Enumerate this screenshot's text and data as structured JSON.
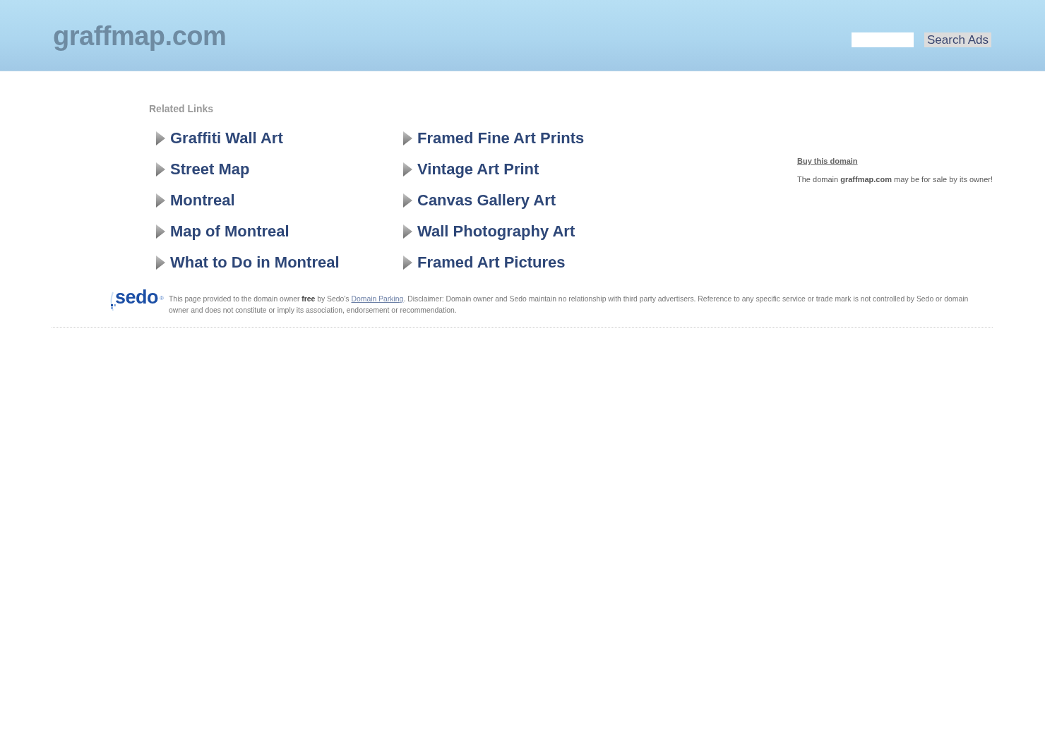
{
  "header": {
    "logo": "graffmap.com",
    "search_button": "Search Ads"
  },
  "related_links": {
    "title": "Related Links",
    "columns": [
      [
        "Graffiti Wall Art",
        "Street Map",
        "Montreal",
        "Map of Montreal",
        "What to Do in Montreal"
      ],
      [
        "Framed Fine Art Prints",
        "Vintage Art Print",
        "Canvas Gallery Art",
        "Wall Photography Art",
        "Framed Art Pictures"
      ]
    ]
  },
  "sale_notice": {
    "link": "Buy this domain",
    "text": "The domain **graffmap.com** may be for sale by its owner!"
  },
  "footer": {
    "logo": "sedo$^{®}$",
    "disclaimer": {
      "before": "This page provided to the domain owner **free** by Sedo's ",
      "link": "Domain Parking",
      "after": ". Disclaimer: Domain owner and Sedo maintain no relationship with third party advertisers. Reference to any specific service or trade mark is not controlled by Sedo or domain owner and does not constitute or imply its association, endorsement or recommendation."
    }
  }
}
